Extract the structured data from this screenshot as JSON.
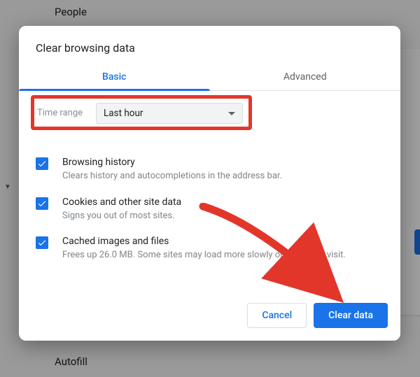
{
  "background": {
    "people": "People",
    "autofill": "Autofill"
  },
  "dialog": {
    "title": "Clear browsing data",
    "tabs": {
      "basic": "Basic",
      "advanced": "Advanced"
    },
    "time": {
      "label": "Time range",
      "value": "Last hour"
    },
    "options": [
      {
        "title": "Browsing history",
        "desc": "Clears history and autocompletions in the address bar."
      },
      {
        "title": "Cookies and other site data",
        "desc": "Signs you out of most sites."
      },
      {
        "title": "Cached images and files",
        "desc": "Frees up 26.0 MB. Some sites may load more slowly on your next visit."
      }
    ],
    "buttons": {
      "cancel": "Cancel",
      "confirm": "Clear data"
    }
  }
}
